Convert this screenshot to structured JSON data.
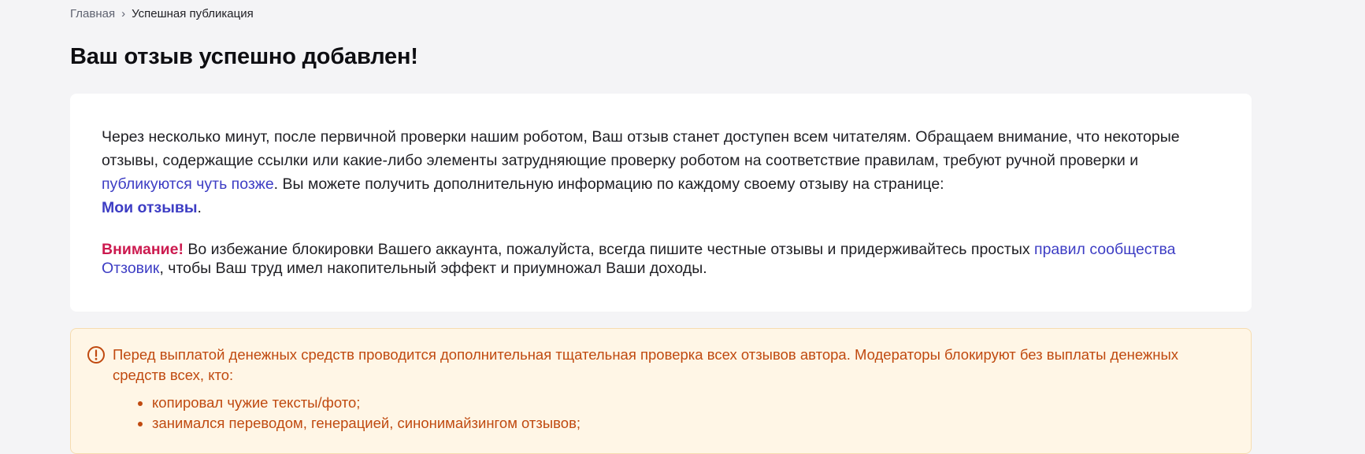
{
  "breadcrumb": {
    "home": "Главная",
    "separator": "›",
    "current": "Успешная публикация"
  },
  "page": {
    "title": "Ваш отзыв успешно добавлен!"
  },
  "info_card": {
    "text_part1": "Через несколько минут, после первичной проверки нашим роботом, Ваш отзыв станет доступен всем читателям. Обращаем внимание, что некоторые отзывы, содержащие ссылки или какие-либо элементы затрудняющие проверку роботом на соответствие правилам, требуют ручной проверки и ",
    "link_later": "публикуются чуть позже",
    "text_part2": ". Вы можете получить дополнительную информацию по каждому своему отзыву на странице: ",
    "link_my_reviews": "Мои отзывы",
    "text_part3": "."
  },
  "warning": {
    "label": "Внимание!",
    "text_part1": " Во избежание блокировки Вашего аккаунта, пожалуйста, всегда пишите честные отзывы и придерживайтесь простых ",
    "link_rules": "правил сообщества Отзовик",
    "text_part2": ", чтобы Ваш труд имел накопительный эффект и приумножал Ваши доходы."
  },
  "notice": {
    "icon": "exclamation-circle-icon",
    "color": "#c04a10",
    "background": "#fff6e6",
    "text": "Перед выплатой денежных средств проводится дополнительная тщательная проверка всех отзывов автора. Модераторы блокируют без выплаты денежных средств всех, кто:",
    "items": [
      "копировал чужие тексты/фото;",
      "занимался переводом, генерацией, синонимайзингом отзывов;"
    ]
  },
  "colors": {
    "page_background": "#f4f4f6",
    "link": "#3d3dc4",
    "attention": "#cc1a4f"
  }
}
